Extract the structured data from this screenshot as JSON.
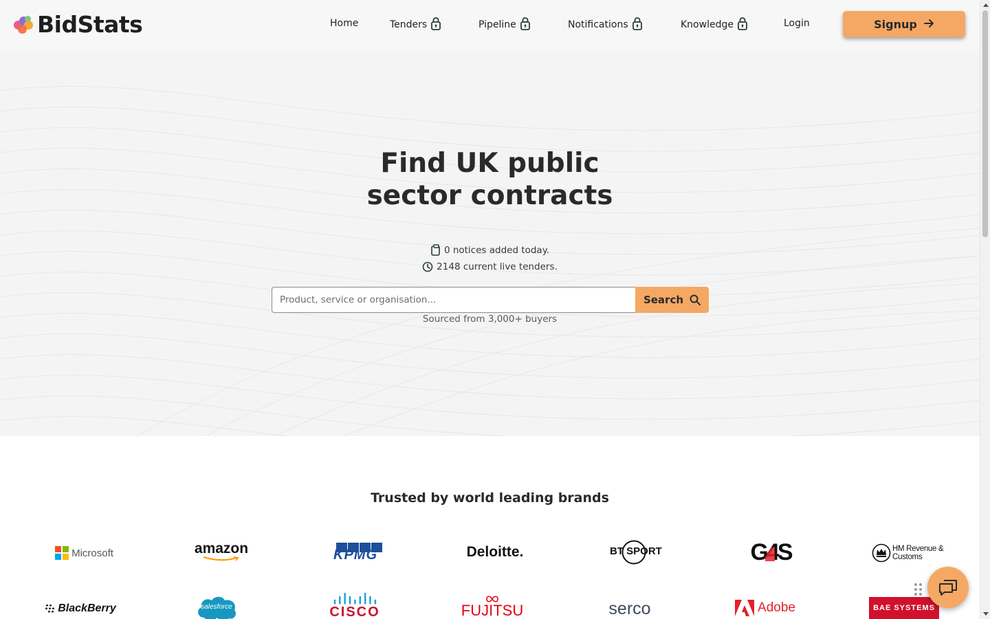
{
  "header": {
    "logo_text": "BidStats",
    "nav": [
      {
        "label": "Home",
        "locked": false
      },
      {
        "label": "Tenders",
        "locked": true
      },
      {
        "label": "Pipeline",
        "locked": true
      },
      {
        "label": "Notifications",
        "locked": true
      },
      {
        "label": "Knowledge",
        "locked": true
      },
      {
        "label": "Login",
        "locked": false
      }
    ],
    "signup_label": "Signup"
  },
  "hero": {
    "title_line1": "Find UK public",
    "title_line2": "sector contracts",
    "notices_today": "0 notices added today.",
    "live_tenders": "2148 current live tenders.",
    "search": {
      "placeholder": "Product, service or organisation...",
      "value": "",
      "button_label": "Search"
    },
    "sourced": "Sourced from 3,000+ buyers"
  },
  "brands": {
    "title": "Trusted by world leading brands",
    "row1": [
      "Microsoft",
      "amazon",
      "KPMG",
      "Deloitte.",
      "BT SPORT",
      "G4S",
      "HM Revenue & Customs"
    ],
    "row2": [
      "BlackBerry",
      "salesforce",
      "CISCO",
      "FUJITSU",
      "serco",
      "Adobe",
      "BAE SYSTEMS"
    ]
  },
  "colors": {
    "accent": "#f4a864",
    "text": "#2a2a2a",
    "hero_bg": "#f4f4f4"
  },
  "icons": [
    "lock-icon",
    "arrow-right-icon",
    "clipboard-icon",
    "clock-icon",
    "search-icon",
    "chat-icon",
    "drag-handle-icon"
  ]
}
